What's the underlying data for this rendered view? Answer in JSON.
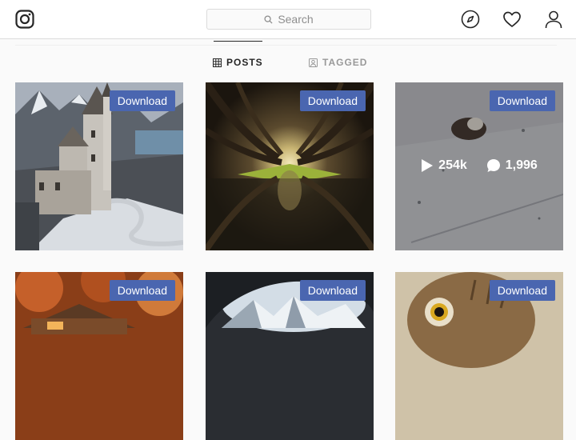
{
  "header": {
    "search_placeholder": "Search",
    "icons": [
      "instagram-logo",
      "compass-icon",
      "heart-icon",
      "user-icon"
    ]
  },
  "tabs": [
    {
      "label": "POSTS",
      "active": true,
      "icon": "grid-icon"
    },
    {
      "label": "TAGGED",
      "active": false,
      "icon": "tag-icon"
    }
  ],
  "posts": [
    {
      "download_label": "Download"
    },
    {
      "download_label": "Download"
    },
    {
      "download_label": "Download",
      "views": "254k",
      "comments": "1,996"
    },
    {
      "download_label": "Download"
    },
    {
      "download_label": "Download"
    },
    {
      "download_label": "Download"
    }
  ],
  "colors": {
    "download_button": "#4a66b0",
    "divider": "#dbdbdb"
  }
}
